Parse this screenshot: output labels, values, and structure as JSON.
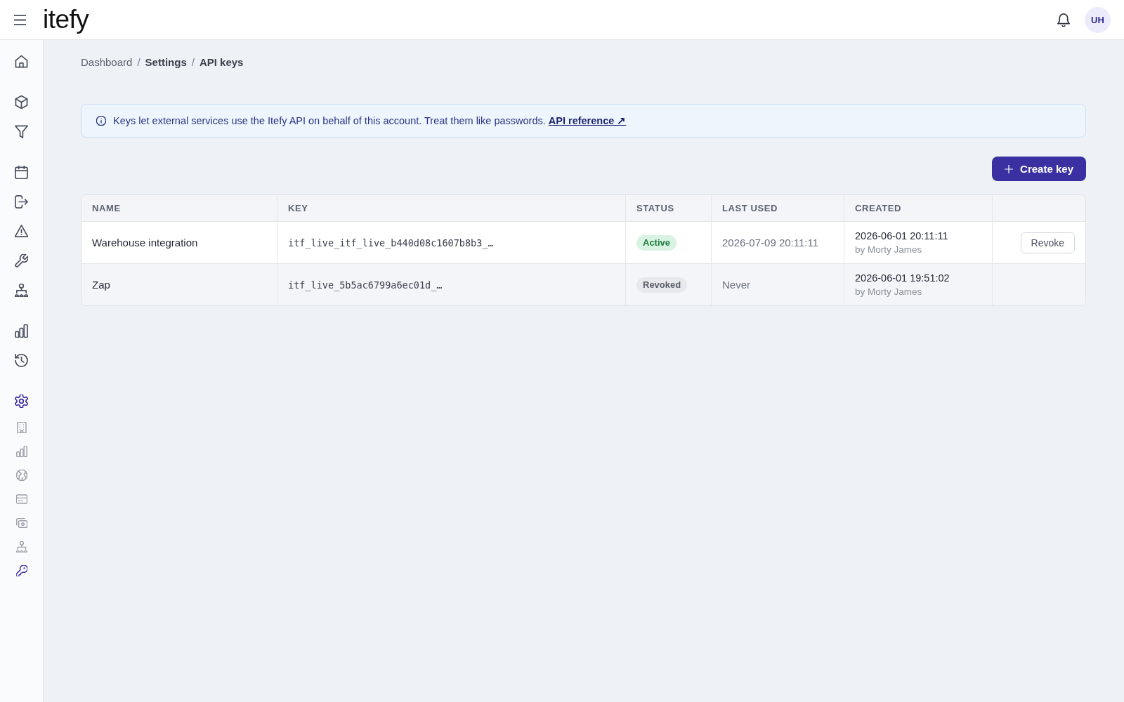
{
  "top_bar": {
    "logo": "itefy",
    "avatar_initials": "UH"
  },
  "sidebar": {
    "sections": [
      {
        "items": [
          {
            "selected": false
          }
        ]
      },
      {
        "items": [
          {
            "selected": false
          },
          {
            "selected": false
          }
        ]
      },
      {
        "items": [
          {
            "selected": false
          },
          {
            "selected": false
          },
          {
            "selected": false
          },
          {
            "selected": false
          },
          {
            "selected": false
          }
        ]
      },
      {
        "items": [
          {
            "selected": false
          },
          {
            "selected": false
          }
        ]
      },
      {
        "items": [
          {
            "selected": true,
            "children": [
              {
                "selected": false
              },
              {
                "selected": false
              },
              {
                "selected": false
              },
              {
                "selected": false
              },
              {
                "selected": false
              },
              {
                "selected": false
              },
              {
                "selected": true
              }
            ]
          }
        ]
      }
    ]
  },
  "breadcrumb": [
    {
      "kind": "link",
      "text": "Dashboard"
    },
    {
      "kind": "separator",
      "text": "/"
    },
    {
      "kind": "section",
      "text": "Settings"
    },
    {
      "kind": "separator",
      "text": "/"
    },
    {
      "kind": "current",
      "text": "API keys"
    }
  ],
  "notice": {
    "text": "Keys let external services use the Itefy API on behalf of this account. Treat them like passwords.",
    "link": "API reference ↗"
  },
  "create_button": "Create key",
  "table": {
    "columns": [
      "NAME",
      "KEY",
      "STATUS",
      "LAST USED",
      "CREATED"
    ],
    "rows": [
      {
        "name": "Warehouse integration",
        "key": "itf_live_itf_live_b440d08c1607b8b3_…",
        "status": {
          "text": "Active",
          "kind": "active"
        },
        "last_used": "2026-07-09 20:11:11",
        "created": {
          "date": "2026-06-01 20:11:11",
          "by": "by Morty James"
        },
        "action": "Revoke"
      },
      {
        "name": "Zap",
        "key": "itf_live_5b5ac6799a6ec01d_…",
        "status": {
          "text": "Revoked",
          "kind": "revoked"
        },
        "last_used": "Never",
        "created": {
          "date": "2026-06-01 19:51:02",
          "by": "by Morty James"
        }
      }
    ]
  }
}
